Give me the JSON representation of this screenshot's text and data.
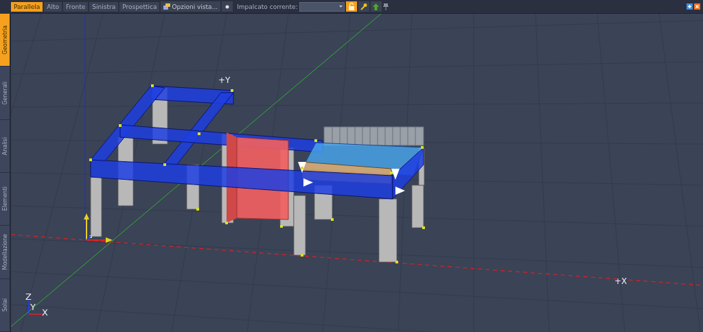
{
  "toolbar": {
    "view_tabs": [
      {
        "label": "Parallela",
        "selected": true
      },
      {
        "label": "Alto",
        "selected": false
      },
      {
        "label": "Fronte",
        "selected": false
      },
      {
        "label": "Sinistra",
        "selected": false
      },
      {
        "label": "Prospettica",
        "selected": false
      }
    ],
    "view_options_button": "Opzioni vista...",
    "floor_label": "Impalcato corrente:",
    "lock_on": true
  },
  "sidebar": {
    "tabs": [
      {
        "label": "Geometria",
        "selected": true
      },
      {
        "label": "Generali",
        "selected": false
      },
      {
        "label": "Analisi",
        "selected": false
      },
      {
        "label": "Elementi",
        "selected": false
      },
      {
        "label": "Modellazione",
        "selected": false
      },
      {
        "label": "Solai",
        "selected": false
      }
    ]
  },
  "viewport": {
    "axis_labels": [
      "+Y",
      "+X"
    ],
    "triad_labels": [
      "Z",
      "Y",
      "X"
    ]
  }
}
